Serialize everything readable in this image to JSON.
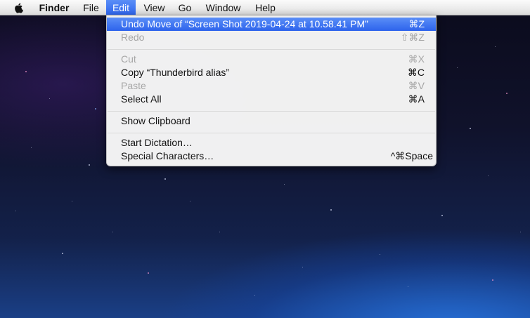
{
  "menubar": {
    "apple_icon": "apple-logo-icon",
    "items": [
      {
        "label": "Finder"
      },
      {
        "label": "File"
      },
      {
        "label": "Edit"
      },
      {
        "label": "View"
      },
      {
        "label": "Go"
      },
      {
        "label": "Window"
      },
      {
        "label": "Help"
      }
    ],
    "active_item": "Edit",
    "highlight_color": "#3a6ff2"
  },
  "edit_menu": {
    "items": [
      {
        "label": "Undo Move of “Screen Shot 2019-04-24 at 10.58.41 PM”",
        "shortcut": "⌘Z",
        "enabled": true,
        "highlighted": true
      },
      {
        "label": "Redo",
        "shortcut": "⇧⌘Z",
        "enabled": false
      },
      {
        "label": "Cut",
        "shortcut": "⌘X",
        "enabled": false
      },
      {
        "label": "Copy “Thunderbird alias”",
        "shortcut": "⌘C",
        "enabled": true
      },
      {
        "label": "Paste",
        "shortcut": "⌘V",
        "enabled": false
      },
      {
        "label": "Select All",
        "shortcut": "⌘A",
        "enabled": true
      },
      {
        "label": "Show Clipboard",
        "shortcut": "",
        "enabled": true
      },
      {
        "label": "Start Dictation…",
        "shortcut": "",
        "enabled": true
      },
      {
        "label": "Special Characters…",
        "shortcut": "^⌘Space",
        "enabled": true
      }
    ]
  }
}
